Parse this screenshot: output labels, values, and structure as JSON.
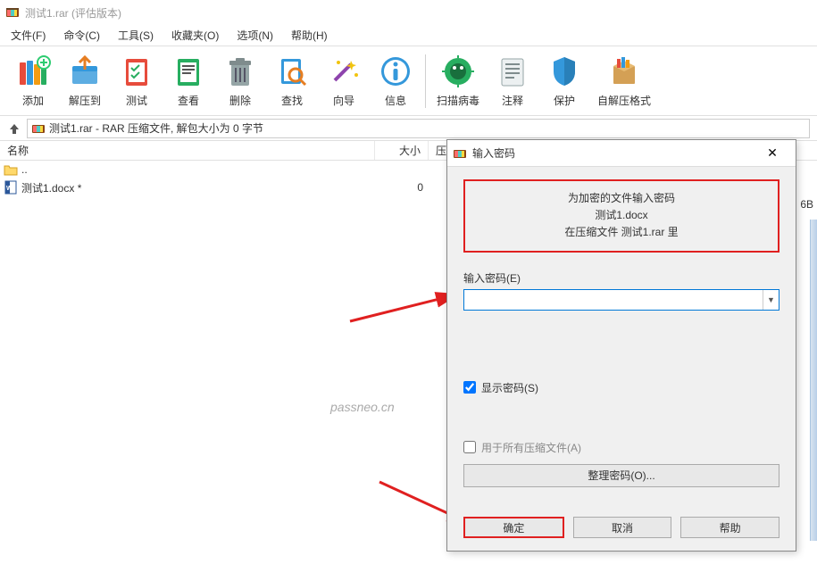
{
  "titlebar": {
    "text": "测试1.rar (评估版本)"
  },
  "menu": [
    {
      "label": "文件(F)"
    },
    {
      "label": "命令(C)"
    },
    {
      "label": "工具(S)"
    },
    {
      "label": "收藏夹(O)"
    },
    {
      "label": "选项(N)"
    },
    {
      "label": "帮助(H)"
    }
  ],
  "toolbar": [
    {
      "name": "add",
      "label": "添加"
    },
    {
      "name": "extract",
      "label": "解压到"
    },
    {
      "name": "test",
      "label": "测试"
    },
    {
      "name": "view",
      "label": "查看"
    },
    {
      "name": "delete",
      "label": "删除"
    },
    {
      "name": "find",
      "label": "查找"
    },
    {
      "name": "wizard",
      "label": "向导"
    },
    {
      "name": "info",
      "label": "信息"
    },
    {
      "sep": true
    },
    {
      "name": "virus",
      "label": "扫描病毒"
    },
    {
      "name": "comment",
      "label": "注释"
    },
    {
      "name": "protect",
      "label": "保护"
    },
    {
      "name": "sfx",
      "label": "自解压格式"
    }
  ],
  "path": {
    "text": "测试1.rar - RAR 压缩文件, 解包大小为 0 字节"
  },
  "columns": {
    "name": "名称",
    "size": "大小",
    "pack": "压缩"
  },
  "files": [
    {
      "name": "..",
      "size": "",
      "icon": "folder"
    },
    {
      "name": "测试1.docx *",
      "size": "0",
      "icon": "docx"
    }
  ],
  "truncated": "6B",
  "watermark": "passneo.cn",
  "dialog": {
    "title": "输入密码",
    "prompt": {
      "line1": "为加密的文件输入密码",
      "line2": "测试1.docx",
      "line3": "在压缩文件 测试1.rar 里"
    },
    "field_label": "输入密码(E)",
    "password_value": "",
    "show_password": {
      "label": "显示密码(S)",
      "checked": true
    },
    "use_all": {
      "label": "用于所有压缩文件(A)",
      "checked": false
    },
    "organize_btn": "整理密码(O)...",
    "ok": "确定",
    "cancel": "取消",
    "help": "帮助"
  }
}
